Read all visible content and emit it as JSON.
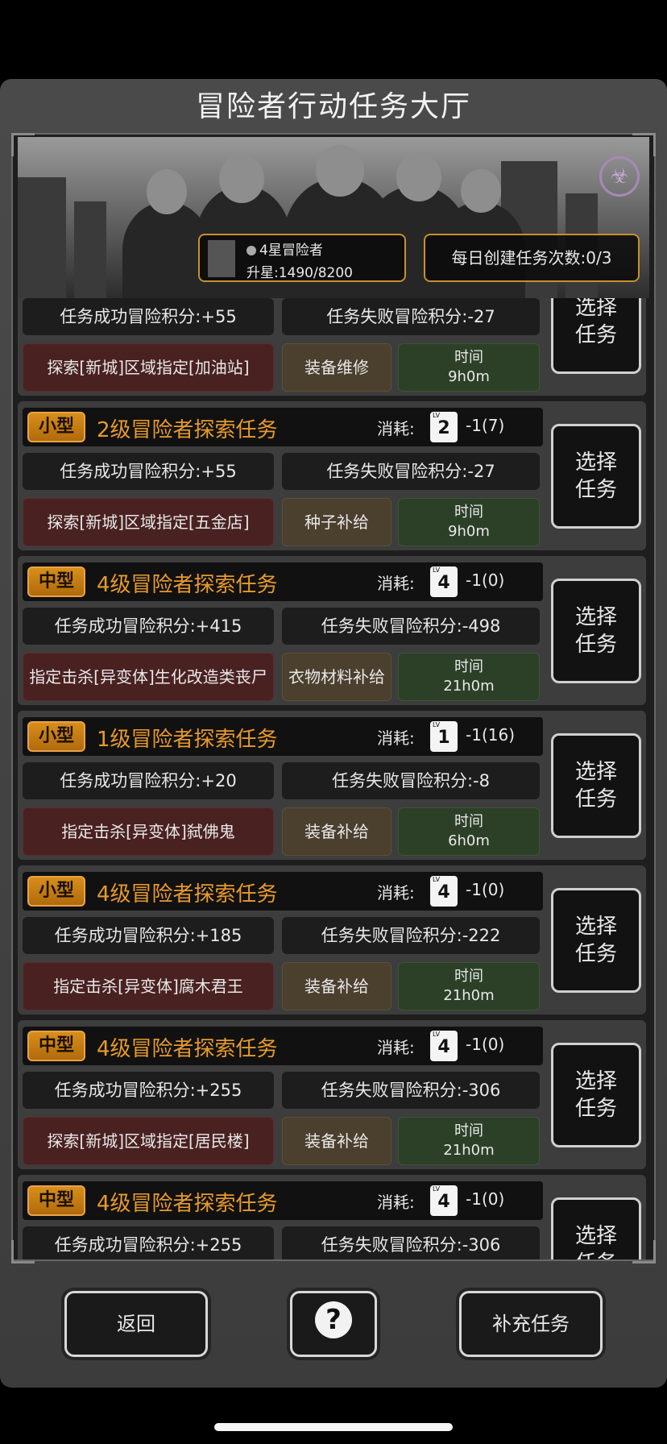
{
  "title": "冒险者行动任务大厅",
  "rank": {
    "name": "4星冒险者",
    "star_progress": "升星:1490/8200"
  },
  "daily_count": "每日创建任务次数:0/3",
  "select_label": [
    "选择",
    "任务"
  ],
  "cost_label": "消耗:",
  "lv_prefix": "LV",
  "time_label": "时间",
  "bio_icon": "☣",
  "partial_top": {
    "success": "任务成功冒险积分:+55",
    "fail": "任务失败冒险积分:-27",
    "location": "探索[新城]区域指定[加油站]",
    "reward": "装备维修",
    "time": "9h0m"
  },
  "tasks": [
    {
      "size": "小型",
      "name": "2级冒险者探索任务",
      "lv": "2",
      "cost": "-1(7)",
      "success": "任务成功冒险积分:+55",
      "fail": "任务失败冒险积分:-27",
      "location": "探索[新城]区域指定[五金店]",
      "reward": "种子补给",
      "time": "9h0m"
    },
    {
      "size": "中型",
      "name": "4级冒险者探索任务",
      "lv": "4",
      "cost": "-1(0)",
      "success": "任务成功冒险积分:+415",
      "fail": "任务失败冒险积分:-498",
      "location": "指定击杀[异变体]生化改造类丧尸",
      "reward": "衣物材料补给",
      "time": "21h0m"
    },
    {
      "size": "小型",
      "name": "1级冒险者探索任务",
      "lv": "1",
      "cost": "-1(16)",
      "success": "任务成功冒险积分:+20",
      "fail": "任务失败冒险积分:-8",
      "location": "指定击杀[异变体]弑佛鬼",
      "reward": "装备补给",
      "time": "6h0m"
    },
    {
      "size": "小型",
      "name": "4级冒险者探索任务",
      "lv": "4",
      "cost": "-1(0)",
      "success": "任务成功冒险积分:+185",
      "fail": "任务失败冒险积分:-222",
      "location": "指定击杀[异变体]腐木君王",
      "reward": "装备补给",
      "time": "21h0m"
    },
    {
      "size": "中型",
      "name": "4级冒险者探索任务",
      "lv": "4",
      "cost": "-1(0)",
      "success": "任务成功冒险积分:+255",
      "fail": "任务失败冒险积分:-306",
      "location": "探索[新城]区域指定[居民楼]",
      "reward": "装备补给",
      "time": "21h0m"
    },
    {
      "size": "中型",
      "name": "4级冒险者探索任务",
      "lv": "4",
      "cost": "-1(0)",
      "success": "任务成功冒险积分:+255",
      "fail": "任务失败冒险积分:-306",
      "location": "",
      "reward": "",
      "time": ""
    }
  ],
  "buttons": {
    "back": "返回",
    "help": "?",
    "refill": "补充任务"
  }
}
